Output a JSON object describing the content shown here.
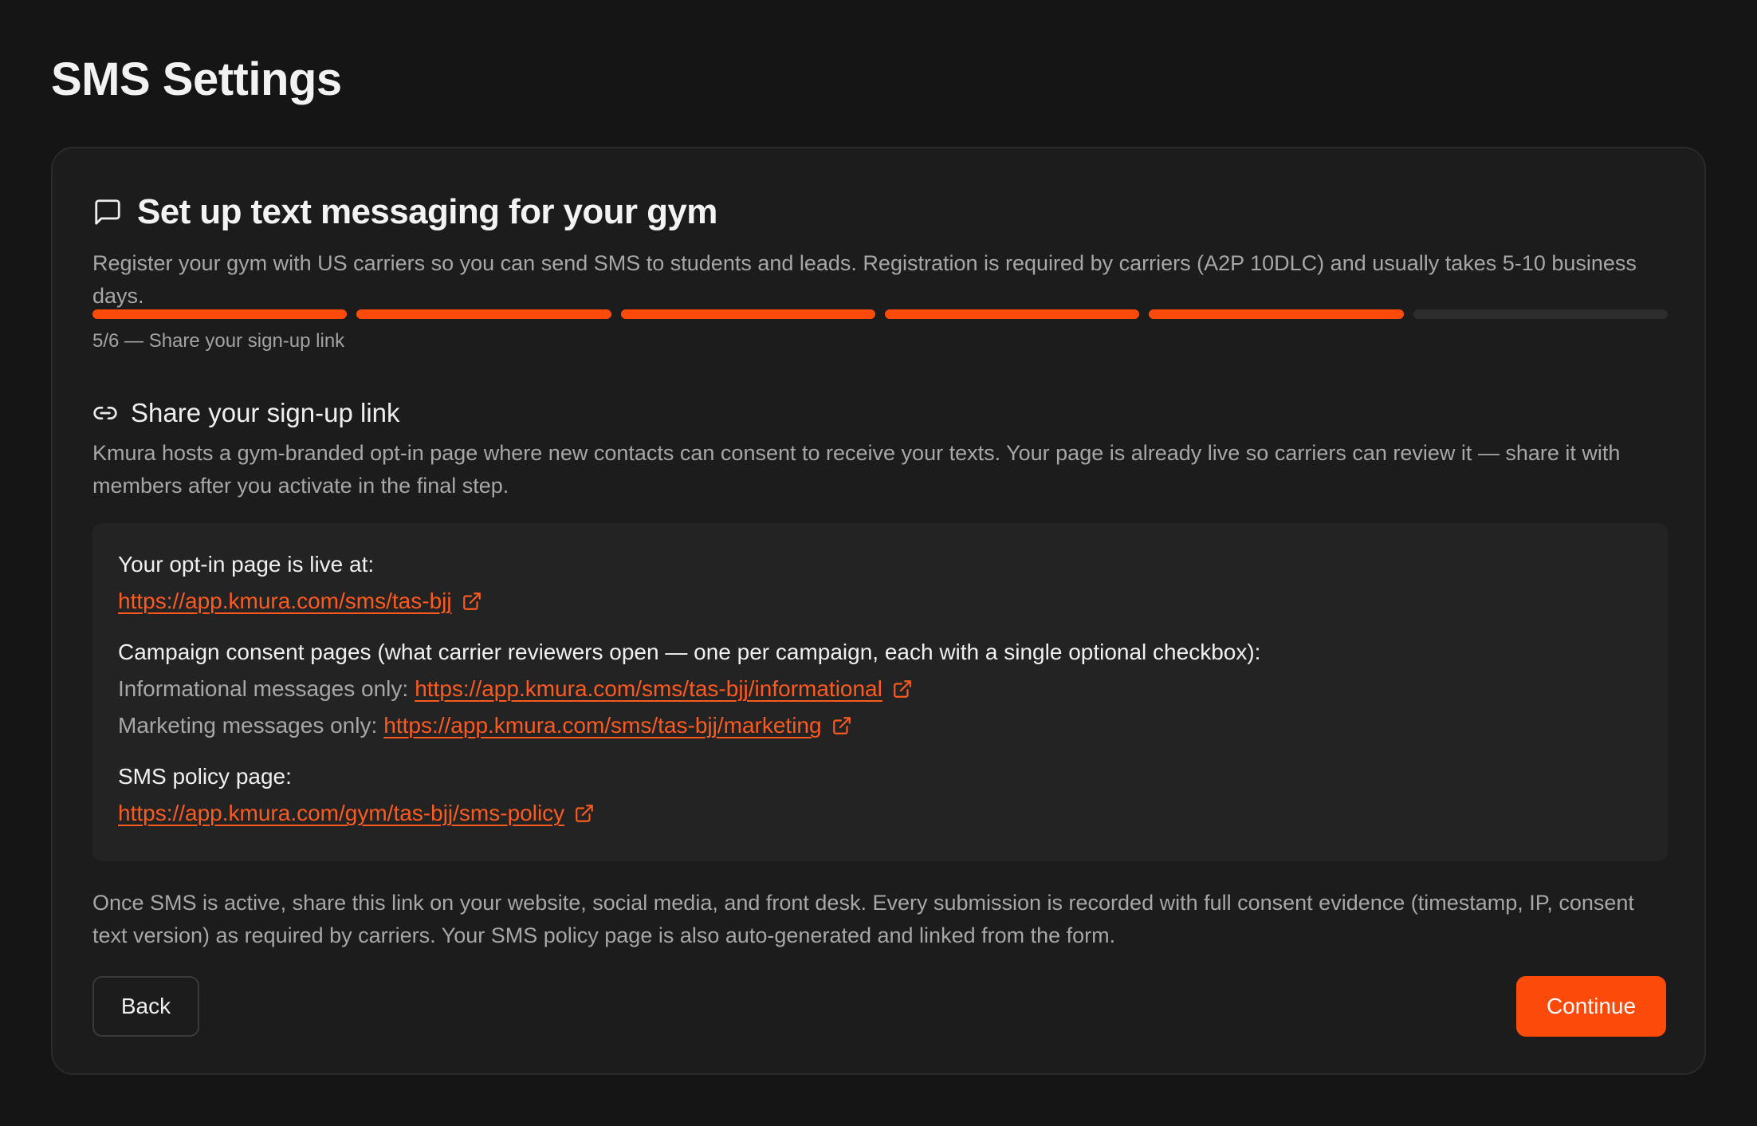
{
  "page": {
    "title": "SMS Settings"
  },
  "card": {
    "icon": "message-square-icon",
    "title": "Set up text messaging for your gym",
    "description": "Register your gym with US carriers so you can send SMS to students and leads. Registration is required by carriers (A2P 10DLC) and usually takes 5-10 business days."
  },
  "progress": {
    "current_step": 5,
    "total_steps": 6,
    "step_label": "5/6 — Share your sign-up link",
    "accent_color": "#fc4a0a"
  },
  "section": {
    "icon": "link-icon",
    "title": "Share your sign-up link",
    "description": "Kmura hosts a gym-branded opt-in page where new contacts can consent to receive your texts. Your page is already live so carriers can review it — share it with members after you activate in the final step."
  },
  "links": {
    "optin_label": "Your opt-in page is live at:",
    "optin_url": "https://app.kmura.com/sms/tas-bjj",
    "campaign_label": "Campaign consent pages (what carrier reviewers open — one per campaign, each with a single optional checkbox):",
    "informational_label": "Informational messages only:",
    "informational_url": "https://app.kmura.com/sms/tas-bjj/informational",
    "marketing_label": "Marketing messages only:",
    "marketing_url": "https://app.kmura.com/sms/tas-bjj/marketing",
    "policy_label": "SMS policy page:",
    "policy_url": "https://app.kmura.com/gym/tas-bjj/sms-policy",
    "external_icon": "external-link-icon"
  },
  "footer_note": "Once SMS is active, share this link on your website, social media, and front desk. Every submission is recorded with full consent evidence (timestamp, IP, consent text version) as required by carriers. Your SMS policy page is also auto-generated and linked from the form.",
  "actions": {
    "back_label": "Back",
    "continue_label": "Continue"
  }
}
